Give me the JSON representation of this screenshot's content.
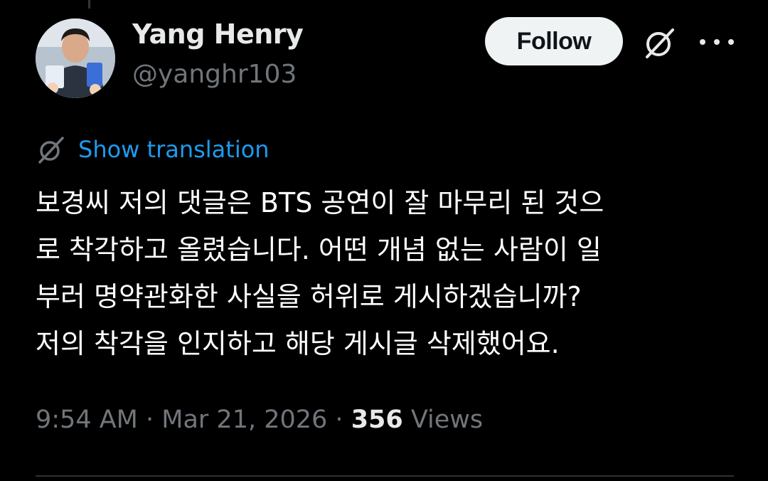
{
  "author": {
    "name": "Yang Henry",
    "handle": "@yanghr103"
  },
  "header_actions": {
    "follow_label": "Follow",
    "grok_icon": "grok-icon",
    "more_icon": "more-dots-icon"
  },
  "translation": {
    "icon": "grok-icon",
    "label": "Show translation"
  },
  "tweet": {
    "lines": [
      "보경씨 저의 댓글은 BTS 공연이 잘 마무리 된 것으",
      "로 착각하고 올렸습니다. 어떤 개념 없는 사람이 일",
      "부러 명약관화한 사실을 허위로 게시하겠습니까?",
      "저의 착각을 인지하고 해당 게시글 삭제했어요."
    ]
  },
  "meta": {
    "time": "9:54 AM",
    "separator": " · ",
    "date": "Mar 21, 2026",
    "views_count": "356",
    "views_label": " Views"
  },
  "colors": {
    "background": "#000000",
    "text_primary": "#e7e9ea",
    "text_secondary": "#71767b",
    "link": "#1d9bf0",
    "follow_bg": "#eff3f4"
  }
}
